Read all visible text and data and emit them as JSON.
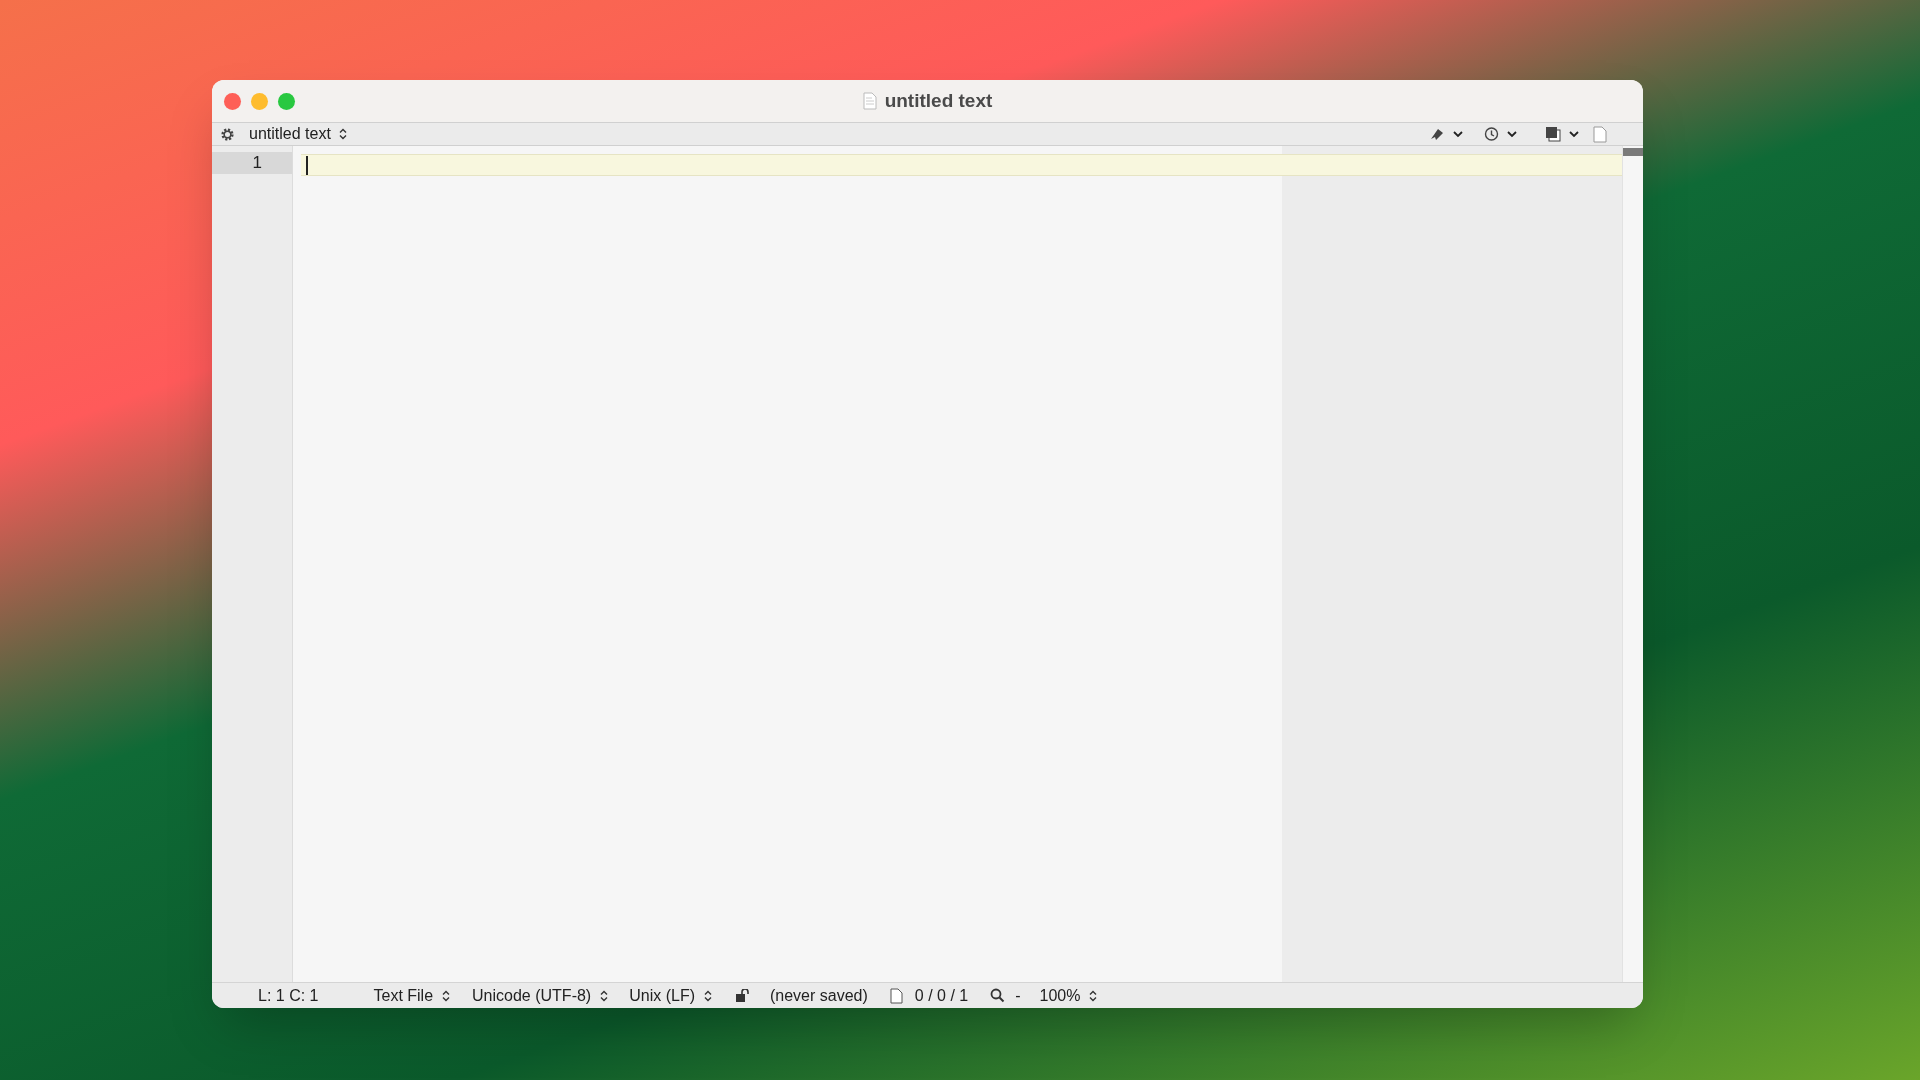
{
  "window": {
    "title": "untitled text"
  },
  "toolbar": {
    "document_menu": "untitled text"
  },
  "editor": {
    "line_numbers": [
      "1"
    ]
  },
  "status_bar": {
    "position": "L: 1 C: 1",
    "syntax": "Text File",
    "encoding": "Unicode (UTF-8)",
    "line_endings": "Unix (LF)",
    "save_state": "(never saved)",
    "counts": "0 / 0 / 1",
    "zoom_separator": "-",
    "zoom": "100%"
  }
}
